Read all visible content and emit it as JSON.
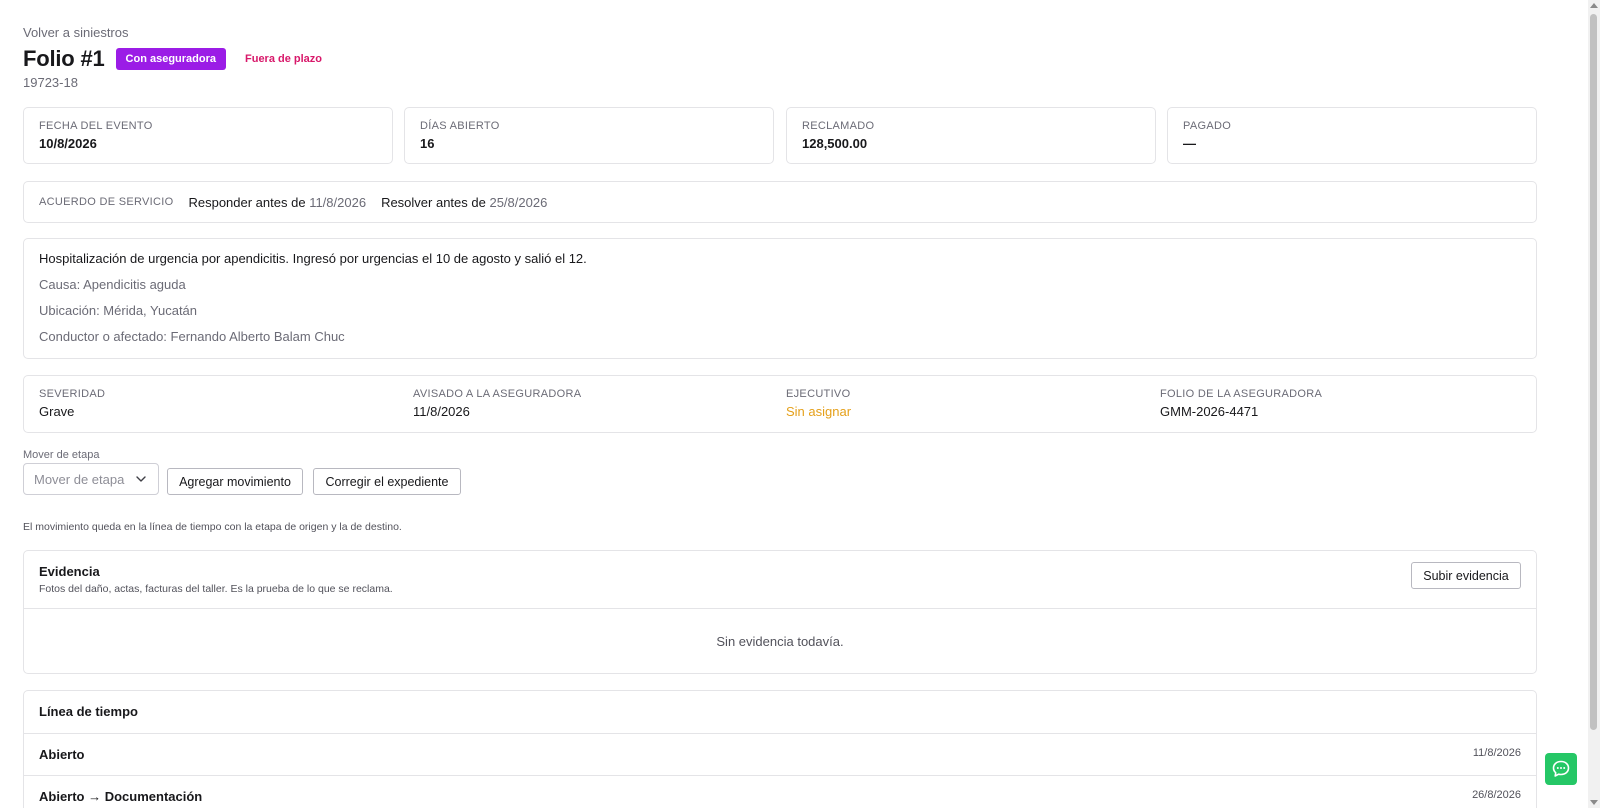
{
  "back_link": "Volver a siniestros",
  "header": {
    "title": "Folio #1",
    "badge_status": "Con aseguradora",
    "badge_deadline": "Fuera de plazo",
    "subtitle": "19723-18"
  },
  "stats": [
    {
      "label": "FECHA DEL EVENTO",
      "value": "10/8/2026"
    },
    {
      "label": "DÍAS ABIERTO",
      "value": "16"
    },
    {
      "label": "RECLAMADO",
      "value": "128,500.00"
    },
    {
      "label": "PAGADO",
      "value": "—"
    }
  ],
  "sla": {
    "label": "ACUERDO DE SERVICIO",
    "respond_prefix": "Responder antes de",
    "respond_date": "11/8/2026",
    "resolve_prefix": "Resolver antes de",
    "resolve_date": "25/8/2026"
  },
  "description": {
    "main": "Hospitalización de urgencia por apendicitis. Ingresó por urgencias el 10 de agosto y salió el 12.",
    "cause": "Causa: Apendicitis aguda",
    "location": "Ubicación: Mérida, Yucatán",
    "driver": "Conductor o afectado: Fernando Alberto Balam Chuc"
  },
  "info": [
    {
      "label": "SEVERIDAD",
      "value": "Grave"
    },
    {
      "label": "AVISADO A LA ASEGURADORA",
      "value": "11/8/2026"
    },
    {
      "label": "EJECUTIVO",
      "value": "Sin asignar"
    },
    {
      "label": "FOLIO DE LA ASEGURADORA",
      "value": "GMM-2026-4471"
    }
  ],
  "actions": {
    "move_label": "Mover de etapa",
    "move_placeholder": "Mover de etapa",
    "add_movement": "Agregar movimiento",
    "correct_file": "Corregir el expediente",
    "hint": "El movimiento queda en la línea de tiempo con la etapa de origen y la de destino."
  },
  "evidence": {
    "title": "Evidencia",
    "subtitle": "Fotos del daño, actas, facturas del taller. Es la prueba de lo que se reclama.",
    "upload_button": "Subir evidencia",
    "empty": "Sin evidencia todavía."
  },
  "timeline": {
    "title": "Línea de tiempo",
    "entries": [
      {
        "stage": "Abierto",
        "date": "11/8/2026"
      },
      {
        "stage": "Abierto → Documentación",
        "date": "26/8/2026"
      }
    ]
  },
  "colors": {
    "badge_status_bg": "#9b1ce6",
    "badge_deadline_text": "#d8186a",
    "unassigned_text": "#e5a01a",
    "chat_button": "#25c766"
  },
  "icons": {
    "select_caret": "chevron-down-icon",
    "chat": "chat-bubble-icon"
  }
}
